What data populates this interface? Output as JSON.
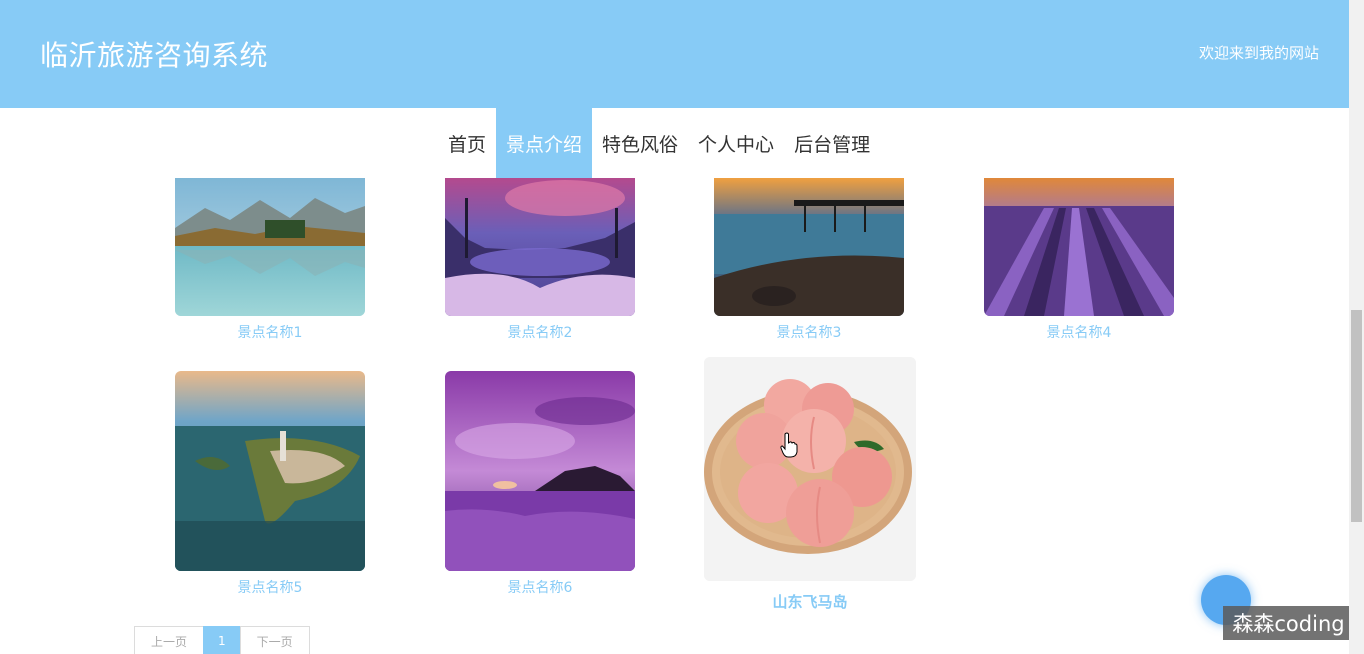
{
  "header": {
    "site_title": "临沂旅游咨询系统",
    "welcome_text": "欢迎来到我的网站"
  },
  "nav": {
    "items": [
      {
        "label": "首页",
        "active": false
      },
      {
        "label": "景点介绍",
        "active": true
      },
      {
        "label": "特色风俗",
        "active": false
      },
      {
        "label": "个人中心",
        "active": false
      },
      {
        "label": "后台管理",
        "active": false
      }
    ]
  },
  "attractions": [
    {
      "name": "景点名称1",
      "image": "mountain-lake-image"
    },
    {
      "name": "景点名称2",
      "image": "crater-lake-image"
    },
    {
      "name": "景点名称3",
      "image": "sunset-pier-image"
    },
    {
      "name": "景点名称4",
      "image": "lavender-field-image"
    },
    {
      "name": "景点名称5",
      "image": "island-town-image"
    },
    {
      "name": "景点名称6",
      "image": "purple-sea-image"
    },
    {
      "name": "山东飞马岛",
      "image": "peaches-image"
    }
  ],
  "pagination": {
    "prev_label": "上一页",
    "current_page": "1",
    "next_label": "下一页"
  },
  "watermark": "森森coding",
  "colors": {
    "primary": "#87cbf6",
    "float_button": "#56a8f0"
  }
}
